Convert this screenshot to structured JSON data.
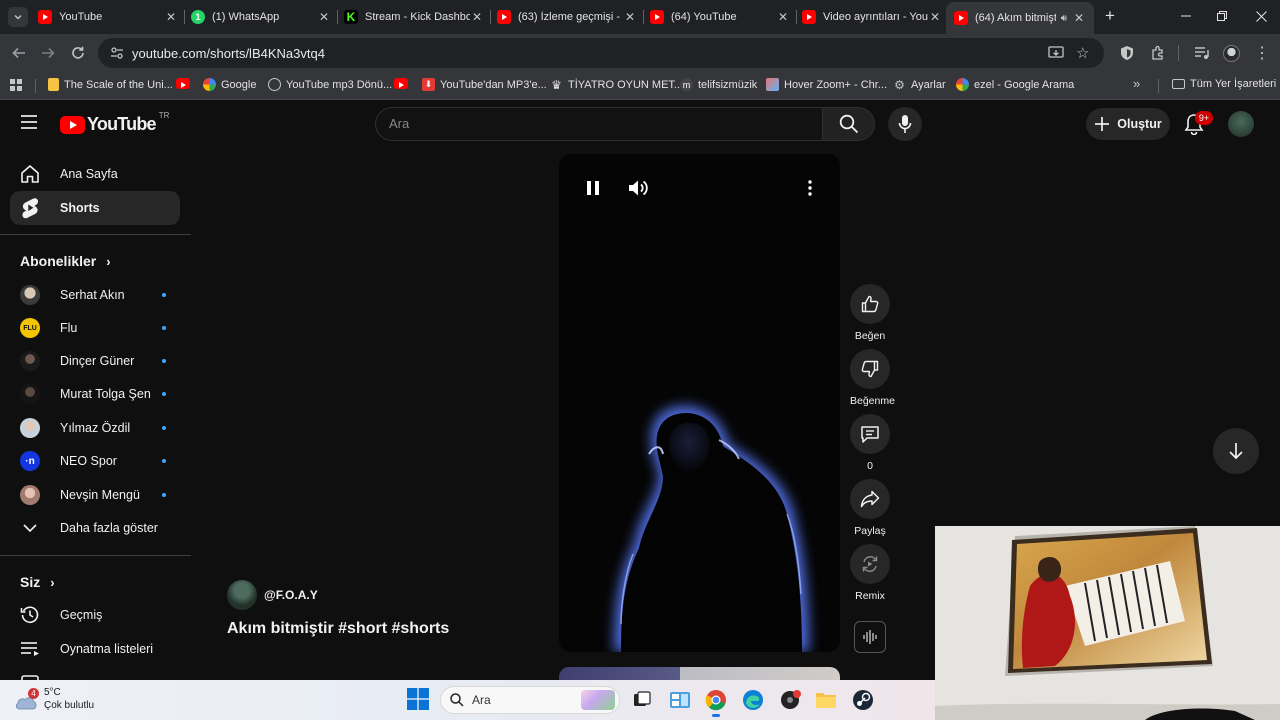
{
  "browser": {
    "tabs": [
      {
        "title": "YouTube",
        "icon": "youtube-icon"
      },
      {
        "title": "(1) WhatsApp",
        "icon": "whatsapp-icon"
      },
      {
        "title": "Stream - Kick Dashbo",
        "icon": "kick-icon"
      },
      {
        "title": "(63) İzleme geçmişi -",
        "icon": "youtube-icon"
      },
      {
        "title": "(64) YouTube",
        "icon": "youtube-icon"
      },
      {
        "title": "Video ayrıntıları - You",
        "icon": "youtube-icon"
      },
      {
        "title": "(64) Akım bitmişt",
        "icon": "youtube-icon",
        "active": true,
        "playing_audio": true
      }
    ],
    "address_bar": {
      "url": "youtube.com/shorts/lB4KNa3vtq4"
    },
    "bookmarks": [
      {
        "label": "The Scale of the Uni...",
        "icon": "page-icon"
      },
      {
        "label": "",
        "icon": "youtube-icon"
      },
      {
        "label": "Google",
        "icon": "google-icon"
      },
      {
        "label": "YouTube mp3 Dönü...",
        "icon": "globe-icon"
      },
      {
        "label": "",
        "icon": "youtube-icon"
      },
      {
        "label": "YouTube'dan MP3'e...",
        "icon": "download-icon"
      },
      {
        "label": "TİYATRO OYUN MET...",
        "icon": "chess-icon"
      },
      {
        "label": "telifsizmüzik",
        "icon": "m-icon"
      },
      {
        "label": "Hover Zoom+ - Chr...",
        "icon": "image-icon"
      },
      {
        "label": "Ayarlar",
        "icon": "gear-icon"
      },
      {
        "label": "ezel - Google Arama",
        "icon": "google-icon"
      }
    ],
    "all_bookmarks_label": "Tüm Yer İşaretleri"
  },
  "youtube": {
    "logo_text": "YouTube",
    "logo_country": "TR",
    "search_placeholder": "Ara",
    "create_label": "Oluştur",
    "notification_badge": "9+",
    "sidebar": {
      "main": [
        {
          "label": "Ana Sayfa",
          "icon": "home-icon"
        },
        {
          "label": "Shorts",
          "icon": "shorts-icon",
          "active": true
        }
      ],
      "subscriptions_header": "Abonelikler",
      "subscriptions": [
        {
          "label": "Serhat Akın",
          "has_new": true
        },
        {
          "label": "Flu",
          "has_new": true,
          "avatar_text": "FLU"
        },
        {
          "label": "Dinçer Güner",
          "has_new": true
        },
        {
          "label": "Murat Tolga Şen",
          "has_new": true
        },
        {
          "label": "Yılmaz Özdil",
          "has_new": true
        },
        {
          "label": "NEO Spor",
          "has_new": true,
          "avatar_text": "·n"
        },
        {
          "label": "Nevşin Mengü",
          "has_new": true
        }
      ],
      "show_more": "Daha fazla göster",
      "you_header": "Siz",
      "you_items": [
        {
          "label": "Geçmiş",
          "icon": "history-icon"
        },
        {
          "label": "Oynatma listeleri",
          "icon": "playlist-icon"
        }
      ]
    },
    "short": {
      "channel": "@F.O.A.Y",
      "title": "Akım bitmiştir #short #shorts"
    },
    "actions": [
      {
        "label": "Beğen",
        "icon": "like-icon"
      },
      {
        "label": "Beğenme",
        "icon": "dislike-icon"
      },
      {
        "label": "0",
        "icon": "comment-icon"
      },
      {
        "label": "Paylaş",
        "icon": "share-icon"
      },
      {
        "label": "Remix",
        "icon": "remix-icon"
      }
    ]
  },
  "taskbar": {
    "weather_temp": "5°C",
    "weather_desc": "Çok bulutlu",
    "weather_badge": "4",
    "search_label": "Ara"
  },
  "colors": {
    "yt_red": "#ff0000",
    "accent_blue": "#3ea6ff",
    "page_bg": "#0f0f0f"
  }
}
